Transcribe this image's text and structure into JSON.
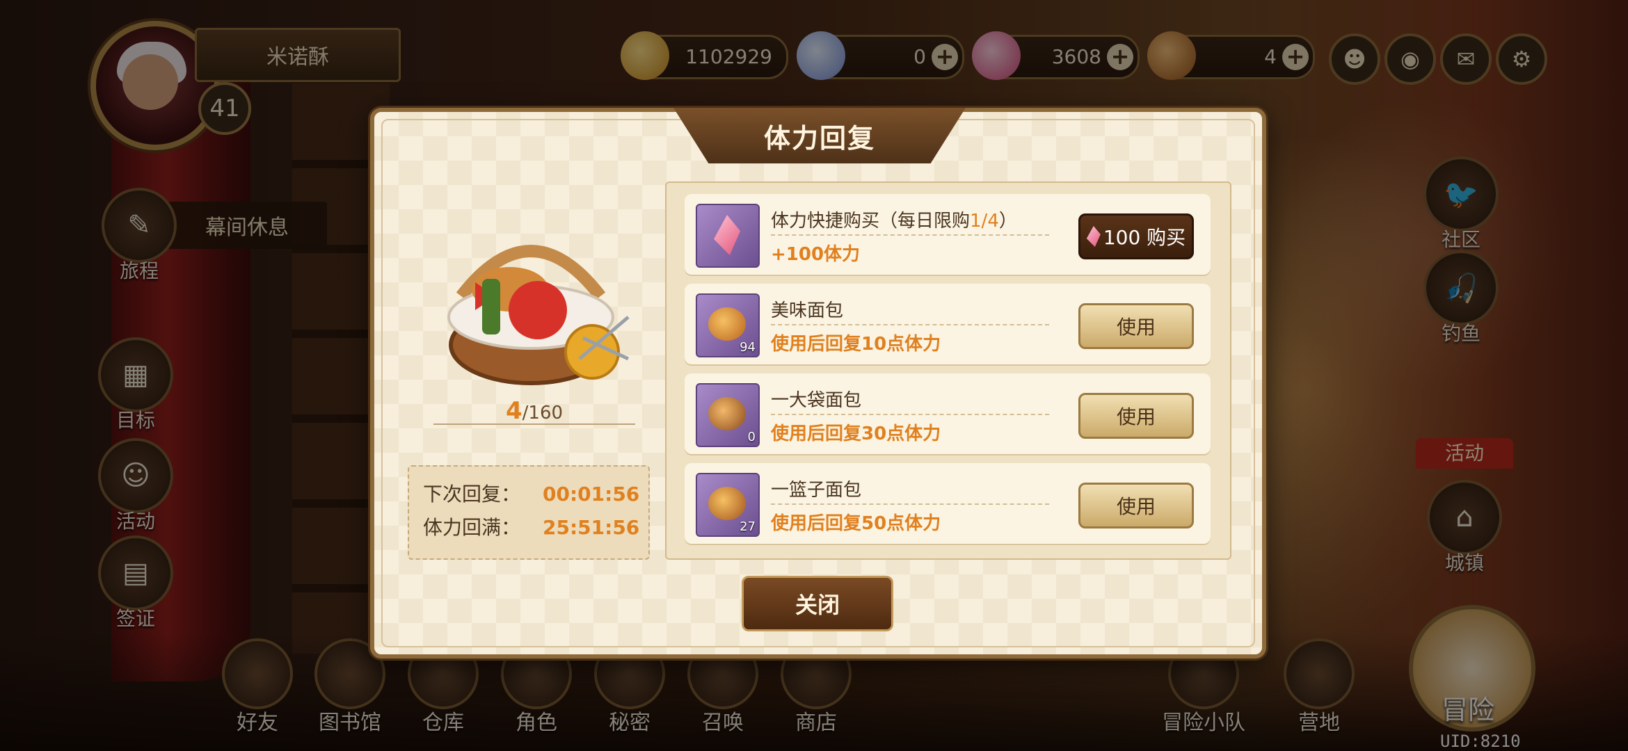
{
  "player": {
    "name": "米诺酥",
    "level": "41"
  },
  "currencies": [
    {
      "icon": "gold-coin-icon",
      "value": "1102929",
      "has_plus": false
    },
    {
      "icon": "diamond-icon",
      "value": "0",
      "has_plus": true
    },
    {
      "icon": "pink-crystal-icon",
      "value": "3608",
      "has_plus": true
    },
    {
      "icon": "bread-icon",
      "value": "4",
      "has_plus": true
    }
  ],
  "top_icons": [
    "mask-icon",
    "broadcast-icon",
    "mail-icon",
    "settings-icon"
  ],
  "left_nav": {
    "rest_label": "幕间休息",
    "items": [
      {
        "label": "旅程",
        "icon": "scroll-icon"
      },
      {
        "label": "目标",
        "icon": "board-icon"
      },
      {
        "label": "活动",
        "icon": "character-icon"
      },
      {
        "label": "签证",
        "icon": "visa-card-icon"
      }
    ]
  },
  "right_nav": {
    "items": [
      {
        "label": "社区",
        "icon": "bird-icon"
      },
      {
        "label": "钓鱼",
        "icon": "fishing-icon"
      },
      {
        "label": "城镇",
        "icon": "town-icon"
      }
    ],
    "activity_badge": "活动"
  },
  "bottom_nav": [
    {
      "label": "好友",
      "icon": "friends-icon"
    },
    {
      "label": "图书馆",
      "icon": "library-icon"
    },
    {
      "label": "仓库",
      "icon": "backpack-icon"
    },
    {
      "label": "角色",
      "icon": "characters-icon"
    },
    {
      "label": "秘密",
      "icon": "secret-icon"
    },
    {
      "label": "召唤",
      "icon": "summon-icon"
    },
    {
      "label": "商店",
      "icon": "shop-icon"
    },
    {
      "label": "冒险小队",
      "icon": "team-icon"
    },
    {
      "label": "营地",
      "icon": "camp-icon"
    }
  ],
  "adventure_label": "冒险",
  "uid": "UID:8210",
  "dialog": {
    "title": "体力回复",
    "stamina_current": "4",
    "stamina_max": "/160",
    "next_recover_label": "下次回复：",
    "next_recover_time": "00:01:56",
    "full_label": "体力回满：",
    "full_time": "25:51:56",
    "items": [
      {
        "title": "体力快捷购买（每日限购",
        "title_hl": "1/4",
        "title_end": "）",
        "desc": "+100体力",
        "qty": "",
        "button": "100 购买",
        "kind": "buy"
      },
      {
        "title": "美味面包",
        "title_hl": "",
        "title_end": "",
        "desc": "使用后回复10点体力",
        "qty": "94",
        "button": "使用",
        "kind": "use"
      },
      {
        "title": "一大袋面包",
        "title_hl": "",
        "title_end": "",
        "desc": "使用后回复30点体力",
        "qty": "0",
        "button": "使用",
        "kind": "use"
      },
      {
        "title": "一篮子面包",
        "title_hl": "",
        "title_end": "",
        "desc": "使用后回复50点体力",
        "qty": "27",
        "button": "使用",
        "kind": "use"
      }
    ],
    "close_label": "关闭"
  },
  "colors": {
    "accent_orange": "#e0801f",
    "dialog_bg": "#f7efdc",
    "frame_brown": "#8d6a3a"
  }
}
